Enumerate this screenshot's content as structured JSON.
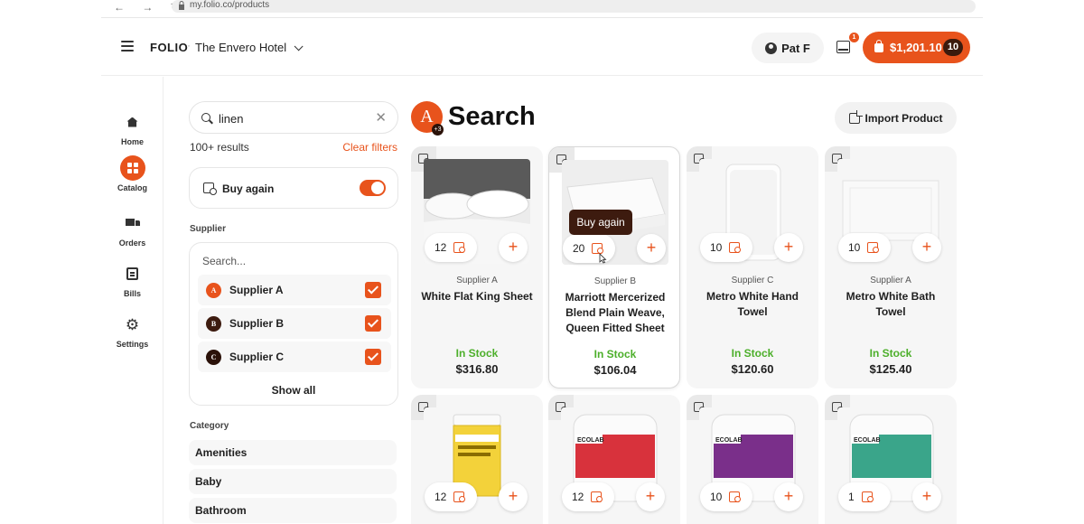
{
  "browser": {
    "url": "my.folio.co/products",
    "nav_glyphs": "← → ↻"
  },
  "header": {
    "brand": "FOLIO",
    "hotel": "The Envero Hotel",
    "user": "Pat F",
    "inbox_badge": "1",
    "cart_total": "$1,201.10",
    "cart_count": "10",
    "accent_color": "#e8531c"
  },
  "nav": [
    {
      "label": "Home",
      "icon": "home-icon"
    },
    {
      "label": "Catalog",
      "icon": "grid-icon",
      "active": true
    },
    {
      "label": "Orders",
      "icon": "truck-icon"
    },
    {
      "label": "Bills",
      "icon": "bill-icon"
    },
    {
      "label": "Settings",
      "icon": "gear-icon"
    }
  ],
  "filters": {
    "search_value": "linen",
    "results": "100+ results",
    "clear_filters": "Clear filters",
    "buy_again": "Buy again",
    "buy_again_on": true,
    "supplier_heading": "Supplier",
    "supplier_search_placeholder": "Search...",
    "suppliers": [
      {
        "letter": "A",
        "name": "Supplier A",
        "color": "#e8531c",
        "checked": true
      },
      {
        "letter": "B",
        "name": "Supplier B",
        "color": "#3d1b0f",
        "checked": true
      },
      {
        "letter": "C",
        "name": "Supplier C",
        "color": "#2b1209",
        "checked": true
      }
    ],
    "show_all": "Show all",
    "category_heading": "Category",
    "categories": [
      "Amenities",
      "Baby",
      "Bathroom"
    ]
  },
  "main": {
    "avatar_letter": "A",
    "avatar_badge": "+3",
    "title": "Search",
    "import_button": "Import Product",
    "tooltip": "Buy again"
  },
  "products": [
    {
      "qty": "12",
      "supplier": "Supplier A",
      "name": "White Flat King Sheet",
      "stock": "In Stock",
      "price": "$316.80"
    },
    {
      "qty": "20",
      "supplier": "Supplier B",
      "name": "Marriott Mercerized Blend Plain Weave, Queen Fitted Sheet",
      "stock": "In Stock",
      "price": "$106.04"
    },
    {
      "qty": "10",
      "supplier": "Supplier C",
      "name": "Metro White Hand Towel",
      "stock": "In Stock",
      "price": "$120.60"
    },
    {
      "qty": "10",
      "supplier": "Supplier A",
      "name": "Metro White Bath Towel",
      "stock": "In Stock",
      "price": "$125.40"
    },
    {
      "qty": "12"
    },
    {
      "qty": "12"
    },
    {
      "qty": "10"
    },
    {
      "qty": "1"
    }
  ],
  "product_labels": {
    "ecolab": "ECOLAB"
  }
}
